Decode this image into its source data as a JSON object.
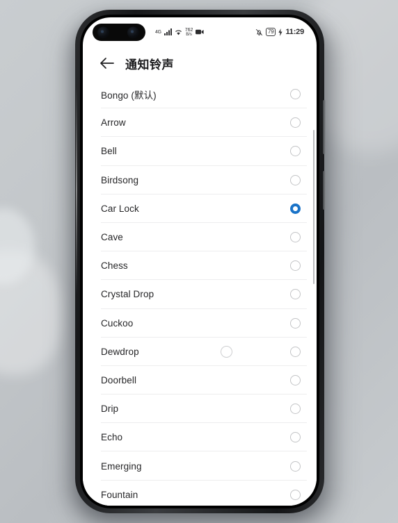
{
  "status_bar": {
    "network_type": "4G",
    "net_speed_value": "762",
    "net_speed_unit": "B/s",
    "signal_icon": "signal-bars-icon",
    "wifi_icon": "wifi-icon",
    "screen_record_icon": "screen-record-icon",
    "mute_icon": "bell-muted-icon",
    "battery_percent": "79",
    "charging_icon": "charging-bolt-icon",
    "time": "11:29"
  },
  "app_bar": {
    "back_icon": "back-arrow-icon",
    "title": "通知铃声"
  },
  "list": {
    "selected": "Car Lock",
    "items": [
      {
        "label": "Bongo (默认)",
        "checked": false
      },
      {
        "label": "Arrow",
        "checked": false
      },
      {
        "label": "Bell",
        "checked": false
      },
      {
        "label": "Birdsong",
        "checked": false
      },
      {
        "label": "Car Lock",
        "checked": true
      },
      {
        "label": "Cave",
        "checked": false
      },
      {
        "label": "Chess",
        "checked": false
      },
      {
        "label": "Crystal Drop",
        "checked": false
      },
      {
        "label": "Cuckoo",
        "checked": false
      },
      {
        "label": "Dewdrop",
        "checked": false
      },
      {
        "label": "Doorbell",
        "checked": false
      },
      {
        "label": "Drip",
        "checked": false
      },
      {
        "label": "Echo",
        "checked": false
      },
      {
        "label": "Emerging",
        "checked": false
      },
      {
        "label": "Fountain",
        "checked": false
      }
    ]
  },
  "overlay": {
    "touch_indicator": "touch-ripple-indicator",
    "pointer": "red-arrow-cursor",
    "target_row": "Dewdrop"
  },
  "colors": {
    "accent_blue": "#1a73c8",
    "row_divider": "#ededee",
    "radio_outline": "#c3c4c6",
    "text_primary": "#252527",
    "touch_red": "#d73c46",
    "phone_frame": "#17181a",
    "desk_background": "#c3c7ca"
  }
}
